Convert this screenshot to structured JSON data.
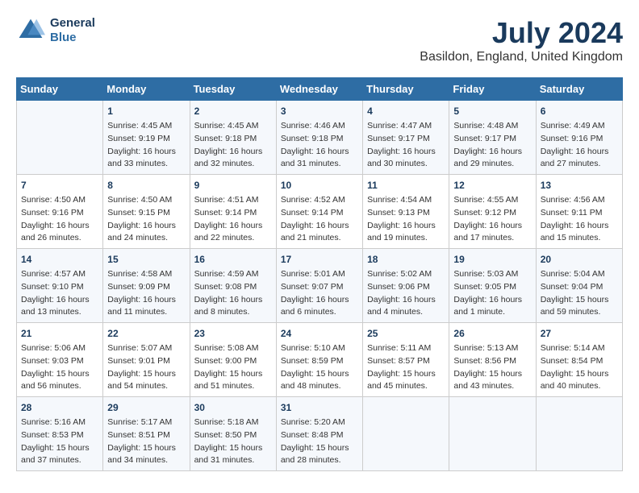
{
  "header": {
    "logo_line1": "General",
    "logo_line2": "Blue",
    "month_year": "July 2024",
    "location": "Basildon, England, United Kingdom"
  },
  "days_of_week": [
    "Sunday",
    "Monday",
    "Tuesday",
    "Wednesday",
    "Thursday",
    "Friday",
    "Saturday"
  ],
  "weeks": [
    [
      {
        "day": "",
        "content": ""
      },
      {
        "day": "1",
        "content": "Sunrise: 4:45 AM\nSunset: 9:19 PM\nDaylight: 16 hours\nand 33 minutes."
      },
      {
        "day": "2",
        "content": "Sunrise: 4:45 AM\nSunset: 9:18 PM\nDaylight: 16 hours\nand 32 minutes."
      },
      {
        "day": "3",
        "content": "Sunrise: 4:46 AM\nSunset: 9:18 PM\nDaylight: 16 hours\nand 31 minutes."
      },
      {
        "day": "4",
        "content": "Sunrise: 4:47 AM\nSunset: 9:17 PM\nDaylight: 16 hours\nand 30 minutes."
      },
      {
        "day": "5",
        "content": "Sunrise: 4:48 AM\nSunset: 9:17 PM\nDaylight: 16 hours\nand 29 minutes."
      },
      {
        "day": "6",
        "content": "Sunrise: 4:49 AM\nSunset: 9:16 PM\nDaylight: 16 hours\nand 27 minutes."
      }
    ],
    [
      {
        "day": "7",
        "content": "Sunrise: 4:50 AM\nSunset: 9:16 PM\nDaylight: 16 hours\nand 26 minutes."
      },
      {
        "day": "8",
        "content": "Sunrise: 4:50 AM\nSunset: 9:15 PM\nDaylight: 16 hours\nand 24 minutes."
      },
      {
        "day": "9",
        "content": "Sunrise: 4:51 AM\nSunset: 9:14 PM\nDaylight: 16 hours\nand 22 minutes."
      },
      {
        "day": "10",
        "content": "Sunrise: 4:52 AM\nSunset: 9:14 PM\nDaylight: 16 hours\nand 21 minutes."
      },
      {
        "day": "11",
        "content": "Sunrise: 4:54 AM\nSunset: 9:13 PM\nDaylight: 16 hours\nand 19 minutes."
      },
      {
        "day": "12",
        "content": "Sunrise: 4:55 AM\nSunset: 9:12 PM\nDaylight: 16 hours\nand 17 minutes."
      },
      {
        "day": "13",
        "content": "Sunrise: 4:56 AM\nSunset: 9:11 PM\nDaylight: 16 hours\nand 15 minutes."
      }
    ],
    [
      {
        "day": "14",
        "content": "Sunrise: 4:57 AM\nSunset: 9:10 PM\nDaylight: 16 hours\nand 13 minutes."
      },
      {
        "day": "15",
        "content": "Sunrise: 4:58 AM\nSunset: 9:09 PM\nDaylight: 16 hours\nand 11 minutes."
      },
      {
        "day": "16",
        "content": "Sunrise: 4:59 AM\nSunset: 9:08 PM\nDaylight: 16 hours\nand 8 minutes."
      },
      {
        "day": "17",
        "content": "Sunrise: 5:01 AM\nSunset: 9:07 PM\nDaylight: 16 hours\nand 6 minutes."
      },
      {
        "day": "18",
        "content": "Sunrise: 5:02 AM\nSunset: 9:06 PM\nDaylight: 16 hours\nand 4 minutes."
      },
      {
        "day": "19",
        "content": "Sunrise: 5:03 AM\nSunset: 9:05 PM\nDaylight: 16 hours\nand 1 minute."
      },
      {
        "day": "20",
        "content": "Sunrise: 5:04 AM\nSunset: 9:04 PM\nDaylight: 15 hours\nand 59 minutes."
      }
    ],
    [
      {
        "day": "21",
        "content": "Sunrise: 5:06 AM\nSunset: 9:03 PM\nDaylight: 15 hours\nand 56 minutes."
      },
      {
        "day": "22",
        "content": "Sunrise: 5:07 AM\nSunset: 9:01 PM\nDaylight: 15 hours\nand 54 minutes."
      },
      {
        "day": "23",
        "content": "Sunrise: 5:08 AM\nSunset: 9:00 PM\nDaylight: 15 hours\nand 51 minutes."
      },
      {
        "day": "24",
        "content": "Sunrise: 5:10 AM\nSunset: 8:59 PM\nDaylight: 15 hours\nand 48 minutes."
      },
      {
        "day": "25",
        "content": "Sunrise: 5:11 AM\nSunset: 8:57 PM\nDaylight: 15 hours\nand 45 minutes."
      },
      {
        "day": "26",
        "content": "Sunrise: 5:13 AM\nSunset: 8:56 PM\nDaylight: 15 hours\nand 43 minutes."
      },
      {
        "day": "27",
        "content": "Sunrise: 5:14 AM\nSunset: 8:54 PM\nDaylight: 15 hours\nand 40 minutes."
      }
    ],
    [
      {
        "day": "28",
        "content": "Sunrise: 5:16 AM\nSunset: 8:53 PM\nDaylight: 15 hours\nand 37 minutes."
      },
      {
        "day": "29",
        "content": "Sunrise: 5:17 AM\nSunset: 8:51 PM\nDaylight: 15 hours\nand 34 minutes."
      },
      {
        "day": "30",
        "content": "Sunrise: 5:18 AM\nSunset: 8:50 PM\nDaylight: 15 hours\nand 31 minutes."
      },
      {
        "day": "31",
        "content": "Sunrise: 5:20 AM\nSunset: 8:48 PM\nDaylight: 15 hours\nand 28 minutes."
      },
      {
        "day": "",
        "content": ""
      },
      {
        "day": "",
        "content": ""
      },
      {
        "day": "",
        "content": ""
      }
    ]
  ]
}
